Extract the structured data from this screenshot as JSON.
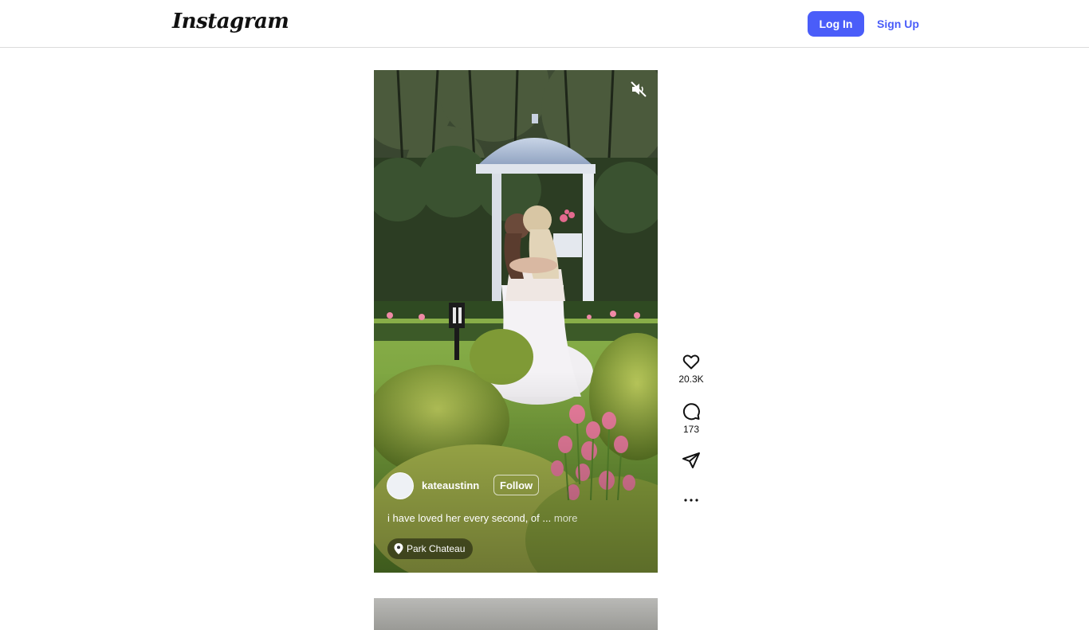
{
  "header": {
    "logo": "Instagram",
    "login_label": "Log In",
    "signup_label": "Sign Up"
  },
  "post": {
    "username": "kateaustinn",
    "follow_label": "Follow",
    "caption": "i have loved her every second, of ...",
    "more_label": "more",
    "location": "Park Chateau"
  },
  "actions": {
    "likes": "20.3K",
    "comments": "173"
  },
  "icons": {
    "mute": "mute-icon",
    "like": "heart-icon",
    "comment": "comment-icon",
    "share": "send-icon",
    "more": "more-icon",
    "location": "location-pin-icon"
  },
  "colors": {
    "accent": "#4a5df9",
    "text": "#111111"
  }
}
